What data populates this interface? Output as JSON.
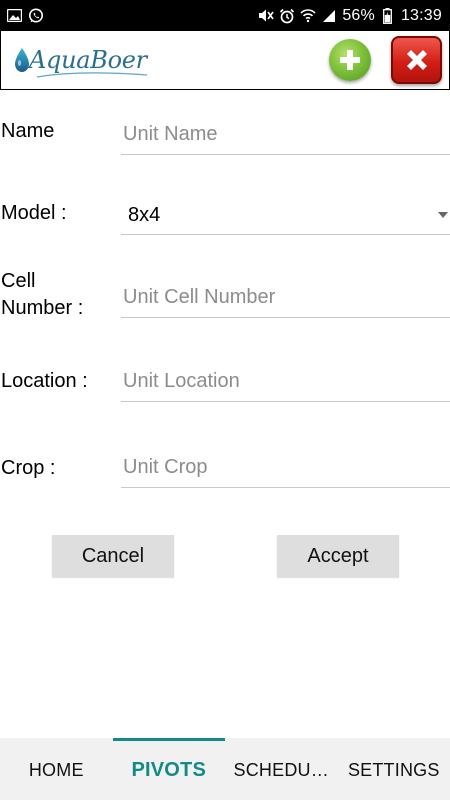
{
  "status_bar": {
    "left_icons": [
      "image-icon",
      "whatsapp-icon"
    ],
    "right_icons": [
      "mute-icon",
      "alarm-icon",
      "wifi-icon",
      "signal-icon",
      "battery-icon"
    ],
    "battery": "56%",
    "time": "13:39"
  },
  "header": {
    "logo_text": "AquaBoer",
    "add_icon": "plus-circle-icon",
    "close_icon": "close-icon"
  },
  "form": {
    "name": {
      "label": "Name",
      "placeholder": "Unit Name"
    },
    "model": {
      "label": "Model :",
      "value": "8x4"
    },
    "cell": {
      "label_line1": "Cell",
      "label_line2": "Number :",
      "placeholder": "Unit Cell Number"
    },
    "location": {
      "label": "Location :",
      "placeholder": "Unit Location"
    },
    "crop": {
      "label": "Crop :",
      "placeholder": "Unit Crop"
    }
  },
  "buttons": {
    "cancel": "Cancel",
    "accept": "Accept"
  },
  "nav": {
    "tabs": [
      {
        "label": "HOME"
      },
      {
        "label": "PIVOTS"
      },
      {
        "label": "SCHEDU…"
      },
      {
        "label": "SETTINGS"
      }
    ],
    "active_tab": "PIVOTS",
    "accent_color": "#148a86"
  }
}
